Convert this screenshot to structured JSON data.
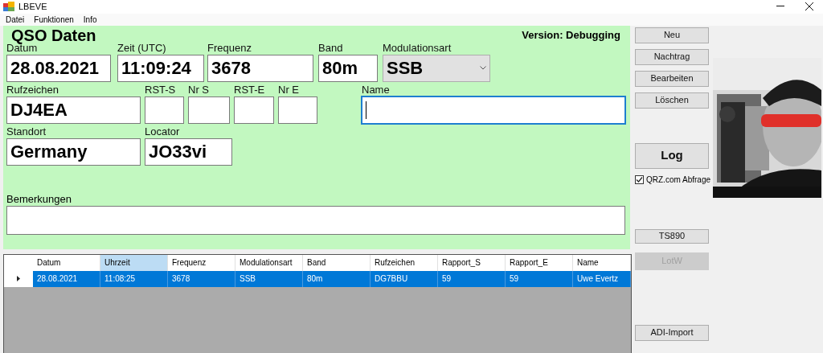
{
  "window": {
    "title": "LBEVE"
  },
  "menu": [
    {
      "label": "Datei"
    },
    {
      "label": "Funktionen"
    },
    {
      "label": "Info"
    }
  ],
  "qso_panel": {
    "heading": "QSO Daten",
    "version": "Version: Debugging",
    "rows": [
      [
        {
          "label": "Datum",
          "value": "28.08.2021",
          "kind": "text",
          "focused": false
        },
        {
          "label": "Zeit (UTC)",
          "value": "11:09:24",
          "kind": "text",
          "focused": false
        },
        {
          "label": "Frequenz",
          "value": "3678",
          "kind": "text",
          "focused": false
        },
        {
          "label": "Band",
          "value": "80m",
          "kind": "text",
          "focused": false
        },
        {
          "label": "Modulationsart",
          "value": "SSB",
          "kind": "dropdown",
          "focused": false
        }
      ],
      [
        {
          "label": "Rufzeichen",
          "value": "DJ4EA",
          "kind": "text",
          "focused": false
        },
        {
          "label": "RST-S",
          "kind": "text",
          "focused": false
        },
        {
          "label": "Nr S",
          "kind": "text",
          "focused": false
        },
        {
          "label": "RST-E",
          "kind": "text",
          "focused": false
        },
        {
          "label": "Nr E",
          "kind": "text",
          "focused": false
        },
        {
          "label": "Name",
          "kind": "text",
          "focused": true
        }
      ],
      [
        {
          "label": "Standort",
          "value": "Germany",
          "kind": "text",
          "focused": false
        },
        {
          "label": "Locator",
          "value": "JO33vi",
          "kind": "text",
          "focused": false
        }
      ]
    ],
    "remarks": {
      "label": "Bemerkungen",
      "focused": false
    }
  },
  "actions": [
    {
      "label": "Neu",
      "disabled": false
    },
    {
      "label": "Nachtrag",
      "disabled": false
    },
    {
      "label": "Bearbeiten",
      "disabled": false
    },
    {
      "label": "Löschen",
      "disabled": false
    }
  ],
  "log_button": {
    "label": "Log",
    "disabled": false
  },
  "qrz_lookup": {
    "label": "QRZ.com Abfrage",
    "checked": true
  },
  "tools": [
    {
      "label": "TS890",
      "disabled": false
    },
    {
      "label": "LotW",
      "disabled": true
    }
  ],
  "import_button": {
    "label": "ADI-Import",
    "disabled": false
  },
  "table": {
    "columns": [
      {
        "label": "Datum",
        "highlighted": false
      },
      {
        "label": "Uhrzeit",
        "highlighted": true
      },
      {
        "label": "Frequenz",
        "highlighted": false
      },
      {
        "label": "Modulationsart",
        "highlighted": false
      },
      {
        "label": "Band",
        "highlighted": false
      },
      {
        "label": "Rufzeichen",
        "highlighted": false
      },
      {
        "label": "Rapport_S",
        "highlighted": false
      },
      {
        "label": "Rapport_E",
        "highlighted": false
      },
      {
        "label": "Name",
        "highlighted": false
      }
    ],
    "rows": [
      {
        "selected": true,
        "cells": [
          "28.08.2021",
          "11:08:25",
          "3678",
          "SSB",
          "80m",
          "DG7BBU",
          "59",
          "59",
          "Uwe Evertz"
        ]
      }
    ]
  }
}
